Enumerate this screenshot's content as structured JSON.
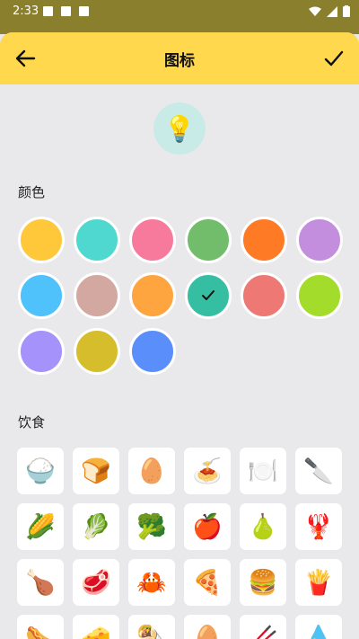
{
  "status": {
    "time": "2:33"
  },
  "header": {
    "title": "图标"
  },
  "preview": {
    "emoji": "💡"
  },
  "sections": {
    "colors": "颜色",
    "food": "饮食"
  },
  "colors": [
    "#ffc83a",
    "#4fd8cf",
    "#f7799b",
    "#72bd6c",
    "#ff7a24",
    "#c48ede",
    "#4fc1fb",
    "#d2a8a0",
    "#ffa53f",
    "#36bea2",
    "#ee7873",
    "#a4dc2b",
    "#a592fb",
    "#d5bd2b",
    "#5a8ffb"
  ],
  "selected_color": 9,
  "food_icons": [
    "🍚",
    "🍞",
    "🥚",
    "🍝",
    "🍽️",
    "🔪",
    "🌽",
    "🥬",
    "🥦",
    "🍎",
    "🍐",
    "🦞",
    "🍗",
    "🥩",
    "🦀",
    "🍕",
    "🍔",
    "🍟",
    "🌭",
    "🧀",
    "🌯",
    "🥚",
    "🥢",
    "💧"
  ]
}
